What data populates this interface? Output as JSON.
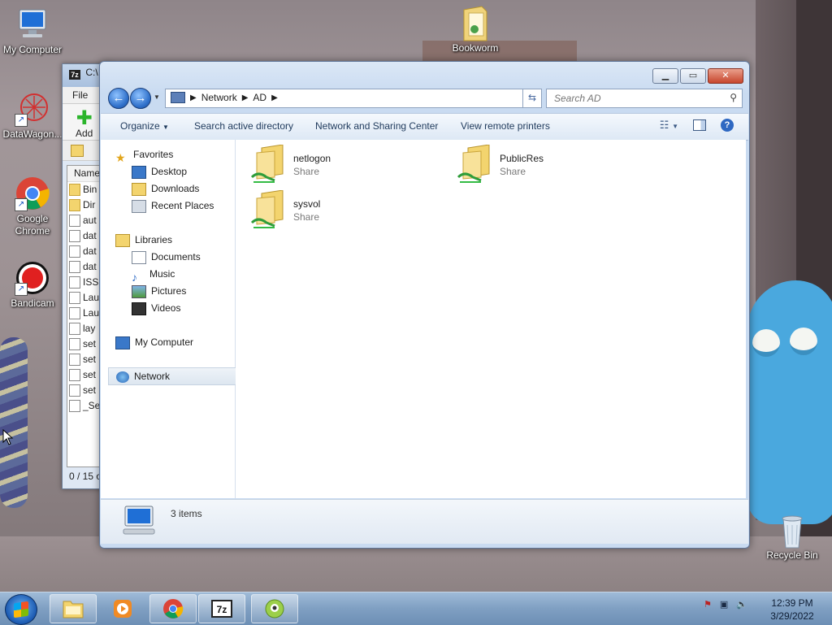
{
  "desktop": {
    "icons": [
      {
        "label": "My Computer"
      },
      {
        "label": "DataWagon..."
      },
      {
        "label": "Google Chrome"
      },
      {
        "label": "Bandicam"
      },
      {
        "label": "Bookworm"
      },
      {
        "label": "Recycle Bin"
      }
    ]
  },
  "zip_window": {
    "title": "C:\\",
    "menu_file": "File",
    "add_label": "Add",
    "column_name": "Name",
    "rows": [
      "Bin",
      "Dir",
      "aut",
      "dat",
      "dat",
      "dat",
      "ISS",
      "Lau",
      "Lau",
      "lay",
      "set",
      "set",
      "set",
      "set",
      "_Se"
    ],
    "status": "0 / 15 o"
  },
  "explorer": {
    "breadcrumb": [
      "Network",
      "AD"
    ],
    "search_placeholder": "Search AD",
    "commands": {
      "organize": "Organize",
      "search_ad": "Search active directory",
      "network_center": "Network and Sharing Center",
      "remote_printers": "View remote printers"
    },
    "nav": {
      "favorites": "Favorites",
      "desktop": "Desktop",
      "downloads": "Downloads",
      "recent": "Recent Places",
      "libraries": "Libraries",
      "documents": "Documents",
      "music": "Music",
      "pictures": "Pictures",
      "videos": "Videos",
      "my_computer": "My Computer",
      "network": "Network"
    },
    "items": [
      {
        "name": "netlogon",
        "type": "Share"
      },
      {
        "name": "PublicRes",
        "type": "Share"
      },
      {
        "name": "sysvol",
        "type": "Share"
      }
    ],
    "status_count": "3 items"
  },
  "taskbar": {
    "time": "12:39 PM",
    "date": "3/29/2022"
  },
  "colors": {
    "accent": "#2e6fc9",
    "selection": "#dde6f0",
    "folder": "#f3d46e"
  }
}
